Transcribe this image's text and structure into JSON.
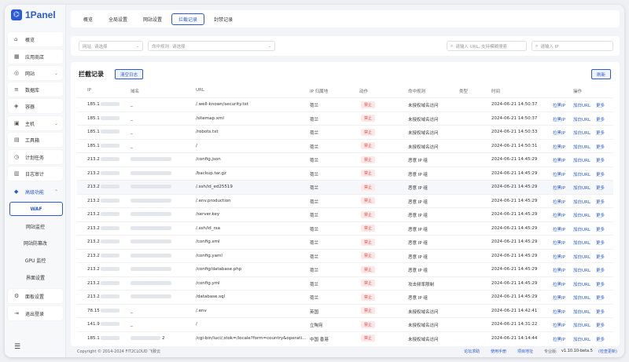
{
  "app": {
    "logo_text": "1Panel"
  },
  "sidebar": {
    "items": [
      {
        "label": "概览",
        "icon": "home-icon",
        "glyph": "⌂"
      },
      {
        "label": "应用商店",
        "icon": "store-icon",
        "glyph": "▦"
      },
      {
        "label": "网站",
        "icon": "globe-icon",
        "glyph": "◎",
        "chev": "⌄"
      },
      {
        "label": "数据库",
        "icon": "database-icon",
        "glyph": "≡"
      },
      {
        "label": "容器",
        "icon": "container-icon",
        "glyph": "◈"
      },
      {
        "label": "主机",
        "icon": "host-icon",
        "glyph": "▣",
        "chev": "⌄"
      },
      {
        "label": "工具箱",
        "icon": "toolbox-icon",
        "glyph": "▤"
      },
      {
        "label": "计划任务",
        "icon": "schedule-icon",
        "glyph": "◷"
      },
      {
        "label": "日志审计",
        "icon": "log-icon",
        "glyph": "▥"
      },
      {
        "label": "高级功能",
        "icon": "diamond-icon",
        "glyph": "◆",
        "chev": "⌃"
      }
    ],
    "sub_items": [
      "WAF",
      "网站监控",
      "网站防篡改",
      "GPU 监控",
      "界面设置"
    ],
    "bottom_items": [
      {
        "label": "面板设置",
        "icon": "settings-icon",
        "glyph": "⚙"
      },
      {
        "label": "退出登录",
        "icon": "logout-icon",
        "glyph": "⇥"
      }
    ],
    "collapse_glyph": "☰"
  },
  "tabs": [
    "概览",
    "全局设置",
    "网站设置",
    "拦截记录",
    "封禁记录"
  ],
  "filters": {
    "site_label": "网站",
    "site_placeholder": "请选择",
    "rule_label": "命中规则",
    "rule_placeholder": "请选择",
    "url_placeholder": "请输入 URL, 支持模糊搜索",
    "ip_placeholder": "请输入 IP"
  },
  "card": {
    "title": "拦截记录",
    "clear_label": "清空日志",
    "refresh_label": "刷新"
  },
  "columns": [
    "IP",
    "域名",
    "URL",
    "IP 归属地",
    "动作",
    "命中规则",
    "类型",
    "时间",
    "操作"
  ],
  "rows": [
    {
      "ip": "185.1",
      "domain": "_",
      "url": "/.well-known/security.txt",
      "loc": "荷兰",
      "action": "禁止",
      "rule": "未授权域名访问",
      "time": "2024-06-21 14:50:37"
    },
    {
      "ip": "185.1",
      "domain": "_",
      "url": "/sitemap.xml",
      "loc": "荷兰",
      "action": "禁止",
      "rule": "未授权域名访问",
      "time": "2024-06-21 14:50:37"
    },
    {
      "ip": "185.1",
      "domain": "_",
      "url": "/robots.txt",
      "loc": "荷兰",
      "action": "禁止",
      "rule": "未授权域名访问",
      "time": "2024-06-21 14:50:33"
    },
    {
      "ip": "185.1",
      "domain": "_",
      "url": "/",
      "loc": "荷兰",
      "action": "禁止",
      "rule": "未授权域名访问",
      "time": "2024-06-21 14:50:31"
    },
    {
      "ip": "213.2",
      "domain": "",
      "url": "/config.json",
      "loc": "荷兰",
      "action": "禁止",
      "rule": "恶意 IP 组",
      "time": "2024-06-21 14:45:29"
    },
    {
      "ip": "213.2",
      "domain": "",
      "url": "/backup.tar.gz",
      "loc": "荷兰",
      "action": "禁止",
      "rule": "恶意 IP 组",
      "time": "2024-06-21 14:45:29"
    },
    {
      "ip": "213.2",
      "domain": "",
      "url": "/.ssh/id_ed25519",
      "loc": "荷兰",
      "action": "禁止",
      "rule": "恶意 IP 组",
      "time": "2024-06-21 14:45:29"
    },
    {
      "ip": "213.2",
      "domain": "",
      "url": "/.env.production",
      "loc": "荷兰",
      "action": "禁止",
      "rule": "恶意 IP 组",
      "time": "2024-06-21 14:45:29"
    },
    {
      "ip": "213.2",
      "domain": "",
      "url": "/server.key",
      "loc": "荷兰",
      "action": "禁止",
      "rule": "恶意 IP 组",
      "time": "2024-06-21 14:45:29"
    },
    {
      "ip": "213.2",
      "domain": "",
      "url": "/.ssh/id_rsa",
      "loc": "荷兰",
      "action": "禁止",
      "rule": "恶意 IP 组",
      "time": "2024-06-21 14:45:29"
    },
    {
      "ip": "213.2",
      "domain": "",
      "url": "/config.xml",
      "loc": "荷兰",
      "action": "禁止",
      "rule": "恶意 IP 组",
      "time": "2024-06-21 14:45:29"
    },
    {
      "ip": "213.2",
      "domain": "",
      "url": "/config.yaml",
      "loc": "荷兰",
      "action": "禁止",
      "rule": "恶意 IP 组",
      "time": "2024-06-21 14:45:29"
    },
    {
      "ip": "213.2",
      "domain": "",
      "url": "/config/database.php",
      "loc": "荷兰",
      "action": "禁止",
      "rule": "恶意 IP 组",
      "time": "2024-06-21 14:45:29"
    },
    {
      "ip": "213.2",
      "domain": "",
      "url": "/config.yml",
      "loc": "荷兰",
      "action": "禁止",
      "rule": "攻击频率限制",
      "time": "2024-06-21 14:45:29"
    },
    {
      "ip": "213.2",
      "domain": "",
      "url": "/database.sql",
      "loc": "荷兰",
      "action": "禁止",
      "rule": "恶意 IP 组",
      "time": "2024-06-21 14:45:29"
    },
    {
      "ip": "78.15",
      "domain": "_",
      "url": "/.env",
      "loc": "英国",
      "action": "禁止",
      "rule": "未授权域名访问",
      "time": "2024-06-21 14:42:41"
    },
    {
      "ip": "141.9",
      "domain": "_",
      "url": "/",
      "loc": "立陶宛",
      "action": "禁止",
      "rule": "未授权域名访问",
      "time": "2024-06-21 14:31:22"
    },
    {
      "ip": "185.1",
      "domain": "2",
      "url": "/cgi-bin/luci/;stok=/locale?form=country&operati...",
      "loc": "中国 香港",
      "action": "禁止",
      "rule": "未授权域名访问",
      "time": "2024-06-21 14:14:44"
    }
  ],
  "row_ops": {
    "ban": "拉黑IP",
    "add_url": "加白URL",
    "more": "更多"
  },
  "footer": {
    "copyright": "Copyright © 2014-2024 FIT2CLOUD 飞致云",
    "forum": "论坛求助",
    "manual": "使用手册",
    "project": "项目地址",
    "edition": "专业版:",
    "version": "v1.10.10-beta.5",
    "update": "(检查更新)"
  },
  "colors": {
    "accent": "#2a5bd7",
    "danger_bg": "#fde8e8",
    "danger_text": "#e05050"
  }
}
